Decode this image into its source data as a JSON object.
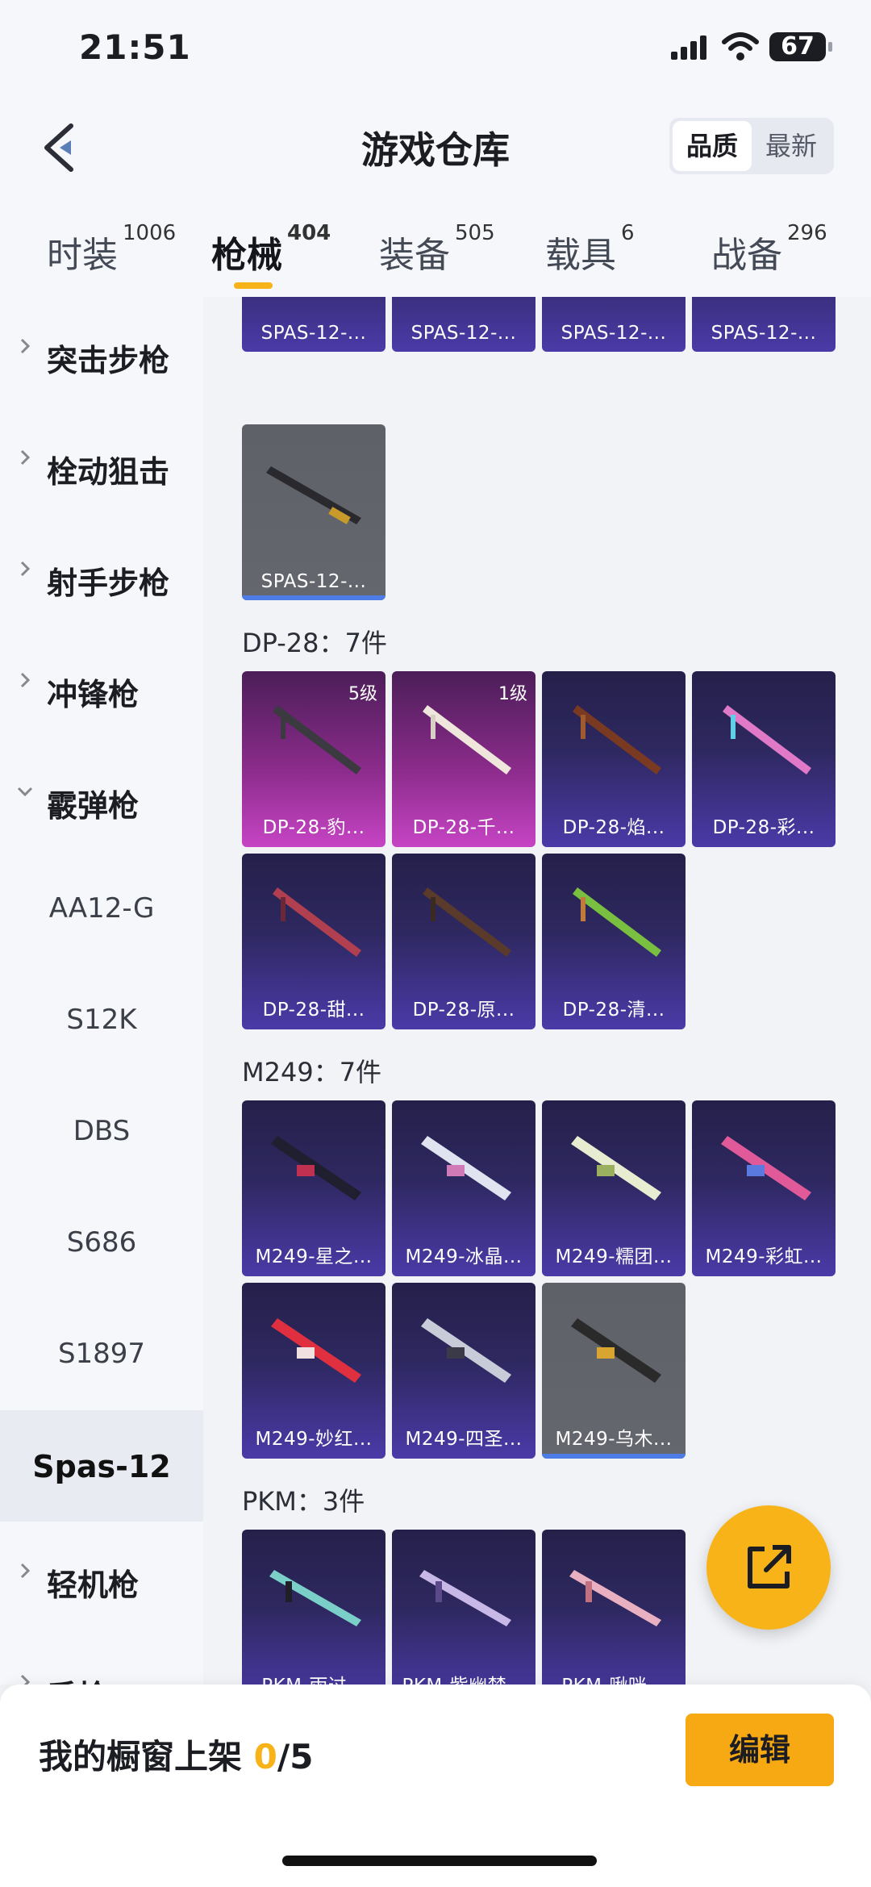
{
  "status": {
    "time": "21:51",
    "battery": "67"
  },
  "header": {
    "title": "游戏仓库",
    "sort_quality": "品质",
    "sort_newest": "最新"
  },
  "tabs": [
    {
      "label": "时装",
      "count": "1006"
    },
    {
      "label": "枪械",
      "count": "404"
    },
    {
      "label": "装备",
      "count": "505"
    },
    {
      "label": "载具",
      "count": "6"
    },
    {
      "label": "战备",
      "count": "296"
    }
  ],
  "sidebar": {
    "categories": [
      "突击步枪",
      "栓动狙击",
      "射手步枪",
      "冲锋枪",
      "霰弹枪",
      "轻机枪",
      "手枪"
    ],
    "shotgun_models": [
      "AA12-G",
      "S12K",
      "DBS",
      "S686",
      "S1897",
      "Spas-12"
    ]
  },
  "sections": {
    "spas": [
      "SPAS-12-...",
      "SPAS-12-...",
      "SPAS-12-...",
      "SPAS-12-...",
      "SPAS-12-..."
    ],
    "dp28_title": "DP-28：7件",
    "dp28": [
      "DP-28-豹...",
      "DP-28-千...",
      "DP-28-焰...",
      "DP-28-彩...",
      "DP-28-甜...",
      "DP-28-原...",
      "DP-28-清..."
    ],
    "dp28_levels": [
      "5级",
      "1级"
    ],
    "m249_title": "M249：7件",
    "m249": [
      "M249-星之...",
      "M249-冰晶...",
      "M249-糯团...",
      "M249-彩虹...",
      "M249-妙红...",
      "M249-四圣...",
      "M249-乌木..."
    ],
    "pkm_title": "PKM：3件",
    "pkm": [
      "PKM-雨过...",
      "PKM-紫幽梦...",
      "PKM-啾咪..."
    ]
  },
  "bottom": {
    "shelf_label": "我的橱窗上架 ",
    "shelf_current": "0",
    "shelf_total": "/5",
    "edit_label": "编辑"
  },
  "icons": {
    "back": "back-arrow-icon",
    "share": "share-icon",
    "expand": "chevron-right-icon",
    "collapse": "chevron-down-icon"
  },
  "colors": {
    "accent": "#f7b317",
    "rare_card": "#4a3aa8",
    "legend_card": "#c644c4",
    "basic_card": "#64676e"
  }
}
